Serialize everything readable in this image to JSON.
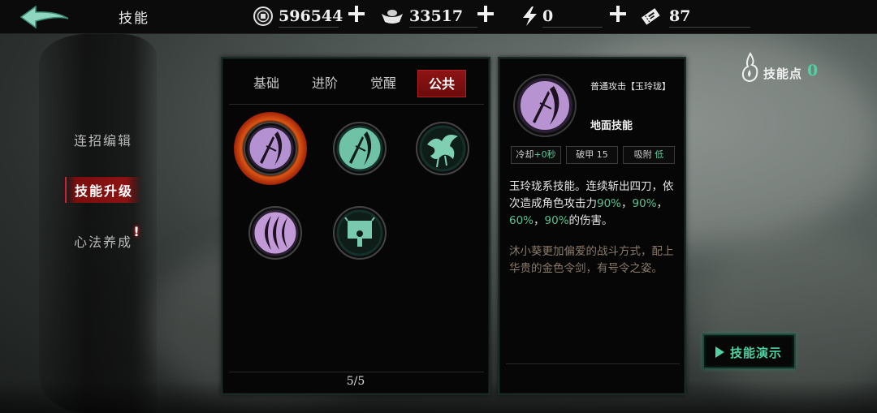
{
  "header": {
    "title": "技能",
    "resources": [
      {
        "name": "coin",
        "icon": "coin-icon",
        "value": "596544"
      },
      {
        "name": "silver",
        "icon": "silver-ingot-icon",
        "value": "33517"
      },
      {
        "name": "stamina",
        "icon": "lightning-icon",
        "value": "0"
      },
      {
        "name": "ticket",
        "icon": "ticket-icon",
        "value": "87"
      }
    ]
  },
  "sidebar": {
    "items": [
      {
        "label": "连招编辑",
        "active": false
      },
      {
        "label": "技能升级",
        "active": true
      },
      {
        "label": "心法养成",
        "active": false,
        "alert": true
      }
    ],
    "alert_mark": "!"
  },
  "skills": {
    "tabs": [
      {
        "label": "基础",
        "active": false
      },
      {
        "label": "进阶",
        "active": false
      },
      {
        "label": "觉醒",
        "active": false
      },
      {
        "label": "公共",
        "active": true
      }
    ],
    "slots": [
      {
        "icon": "slash-blade-icon",
        "tint": "purple",
        "selected": true
      },
      {
        "icon": "slash-blade-icon",
        "tint": "green",
        "selected": false
      },
      {
        "icon": "crane-icon",
        "tint": "green",
        "selected": false
      },
      {
        "icon": "crescent-wave-icon",
        "tint": "purple",
        "selected": false
      },
      {
        "icon": "banner-figure-icon",
        "tint": "green",
        "selected": false
      }
    ],
    "page": "5/5"
  },
  "detail": {
    "name": "普通攻击【玉玲珑】",
    "type": "地面技能",
    "stats": [
      {
        "label": "冷却",
        "value": "+0秒"
      },
      {
        "label": "破甲",
        "value": "15"
      },
      {
        "label": "吸附",
        "value": "低"
      }
    ],
    "description_parts": [
      "玉玲珑系技能。连续斩出四刀，依次造成角色攻击力",
      "90%",
      "，",
      "90%",
      "，",
      "60%",
      "，",
      "90%",
      "的伤害。"
    ],
    "lore": "沐小葵更加偏爱的战斗方式，配上华贵的金色令剑，有号令之姿。"
  },
  "skill_points": {
    "label": "技能点",
    "value": "0"
  },
  "demo_button": {
    "label": "技能演示"
  },
  "colors": {
    "accent_green": "#4fd1a1",
    "active_red": "#8c1212",
    "highlight_green": "#58c28f",
    "lore_brown": "#8a7a67"
  }
}
